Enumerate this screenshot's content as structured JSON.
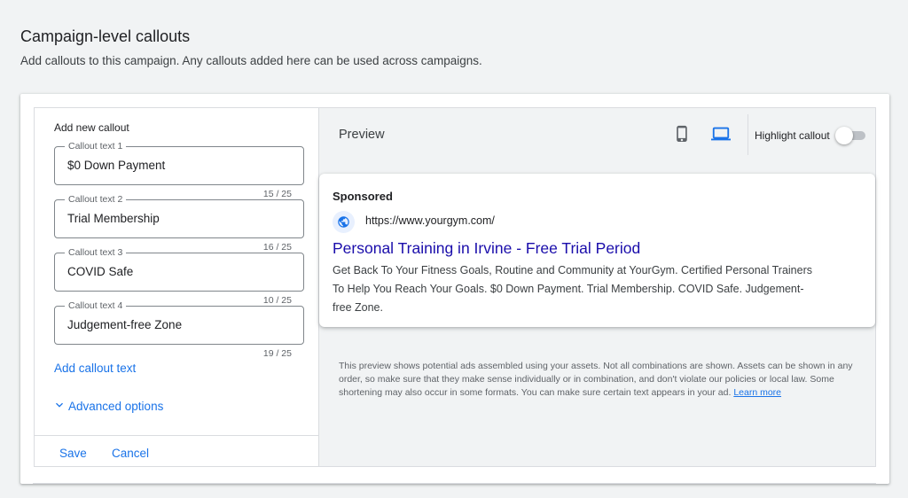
{
  "page": {
    "title": "Campaign-level callouts",
    "subtitle": "Add callouts to this campaign. Any callouts added here can be used across campaigns."
  },
  "editor": {
    "heading": "Add new callout",
    "callouts": [
      {
        "label": "Callout text 1",
        "value": "$0 Down Payment",
        "counter": "15 / 25"
      },
      {
        "label": "Callout text 2",
        "value": "Trial Membership",
        "counter": "16 / 25"
      },
      {
        "label": "Callout text 3",
        "value": "COVID Safe",
        "counter": "10 / 25"
      },
      {
        "label": "Callout text 4",
        "value": "Judgement-free Zone",
        "counter": "19 / 25"
      }
    ],
    "add_link": "Add callout text",
    "advanced_label": "Advanced options",
    "save_label": "Save",
    "cancel_label": "Cancel"
  },
  "preview": {
    "title": "Preview",
    "highlight_label": "Highlight callout",
    "highlight_on": false,
    "selected_device": "desktop",
    "ad": {
      "sponsored": "Sponsored",
      "url": "https://www.yourgym.com/",
      "headline": "Personal Training in Irvine - Free Trial Period",
      "description": "Get Back To Your Fitness Goals, Routine and Community at YourGym. Certified Personal Trainers To Help You Reach Your Goals. $0 Down Payment. Trial Membership. COVID Safe. Judgement-free Zone."
    },
    "disclaimer": "This preview shows potential ads assembled using your assets. Not all combinations are shown. Assets can be shown in any order, so make sure that they make sense individually or in combination, and don't violate our policies or local law. Some shortening may also occur in some formats. You can make sure certain text appears in your ad.",
    "learn_more": "Learn more"
  },
  "colors": {
    "accent": "#1a73e8",
    "headline_link": "#1a0dab",
    "background": "#f1f3f4"
  },
  "icons": [
    "mobile-icon",
    "desktop-icon",
    "globe-icon",
    "chevron-down-icon"
  ]
}
